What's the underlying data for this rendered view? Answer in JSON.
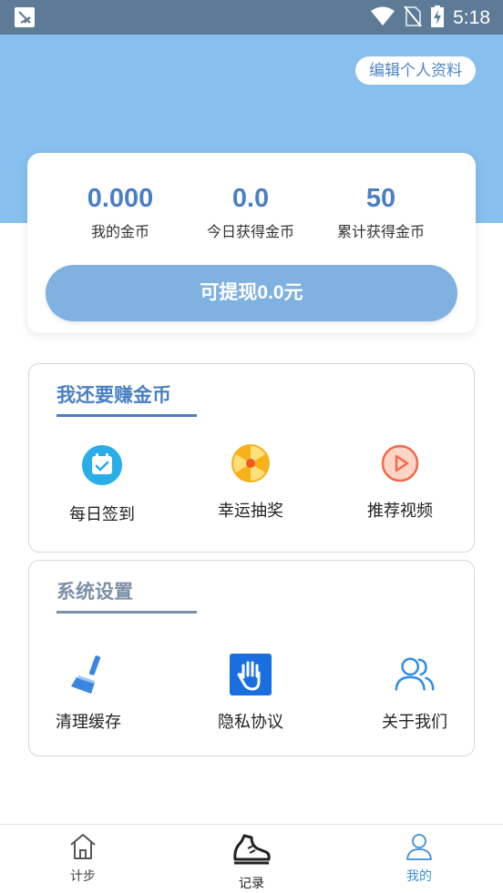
{
  "status_bar": {
    "time": "5:18"
  },
  "header": {
    "edit_profile_label": "编辑个人资料"
  },
  "coin_card": {
    "stats": [
      {
        "value": "0.000",
        "label": "我的金币"
      },
      {
        "value": "0.0",
        "label": "今日获得金币"
      },
      {
        "value": "50",
        "label": "累计获得金币"
      }
    ],
    "withdraw_label": "可提现0.0元"
  },
  "earn_section": {
    "title": "我还要赚金币",
    "items": [
      {
        "label": "每日签到",
        "icon": "calendar-check-icon"
      },
      {
        "label": "幸运抽奖",
        "icon": "lucky-wheel-icon"
      },
      {
        "label": "推荐视频",
        "icon": "play-video-icon"
      }
    ]
  },
  "settings_section": {
    "title": "系统设置",
    "items": [
      {
        "label": "清理缓存",
        "icon": "broom-icon"
      },
      {
        "label": "隐私协议",
        "icon": "hand-stop-icon"
      },
      {
        "label": "关于我们",
        "icon": "users-icon"
      }
    ]
  },
  "bottom_nav": {
    "items": [
      {
        "label": "计步",
        "icon": "home-icon",
        "active": false
      },
      {
        "label": "记录",
        "icon": "shoe-icon",
        "active": false
      },
      {
        "label": "我的",
        "icon": "person-icon",
        "active": true
      }
    ]
  },
  "colors": {
    "status_bar": "#5d7b96",
    "hero": "#87c0ee",
    "accent": "#4b7fc4",
    "withdraw_button": "#7fb1e1",
    "earn_title": "#4b7fc4",
    "settings_title": "#7d8fa6",
    "nav_active": "#3b8fd9"
  }
}
